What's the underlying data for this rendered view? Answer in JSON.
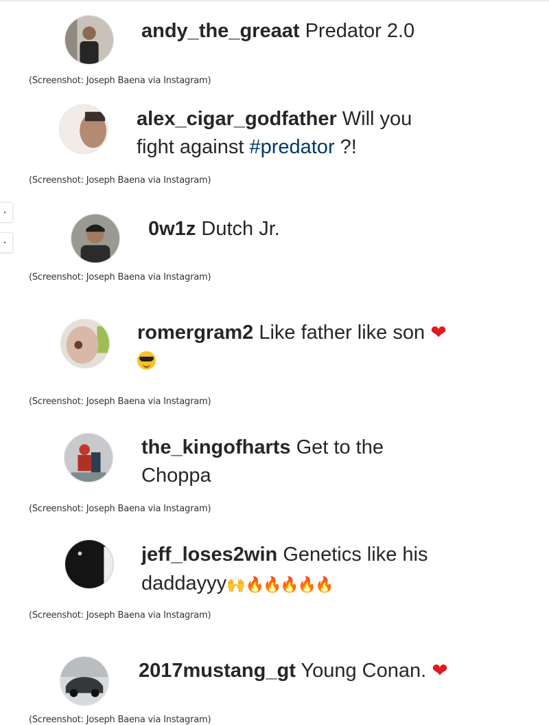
{
  "caption": "(Screenshot: Joseph Baena via Instagram)",
  "colors": {
    "text": "#262626",
    "hashtag": "#00376b",
    "heart": "#e0191f",
    "fire": "#f26b1d"
  },
  "comments": [
    {
      "username": "andy_the_greaat",
      "text": "Predator 2.0"
    },
    {
      "username": "alex_cigar_godfather",
      "text": "Will you",
      "line2_pre": "fight against ",
      "hashtag": "#predator",
      "line2_post": " ?!"
    },
    {
      "username": "0w1z",
      "text": "Dutch Jr."
    },
    {
      "username": "romergram2",
      "text": "Like father like son",
      "emoji": "heart-emoji",
      "line2_emoji": "sunglasses-face-emoji"
    },
    {
      "username": "the_kingofharts",
      "text": "Get to the",
      "line2": "Choppa"
    },
    {
      "username": "jeff_loses2win",
      "text": "Genetics like his",
      "line2": "daddayyy",
      "line2_emojis": "raising-hands-emoji, fire-emoji x5"
    },
    {
      "username": "2017mustang_gt",
      "text": "Young Conan.",
      "emoji": "heart-emoji"
    }
  ],
  "emoji_glyphs": {
    "heart": "❤",
    "fire": "🔥🔥🔥🔥🔥",
    "hands": "🙌"
  }
}
